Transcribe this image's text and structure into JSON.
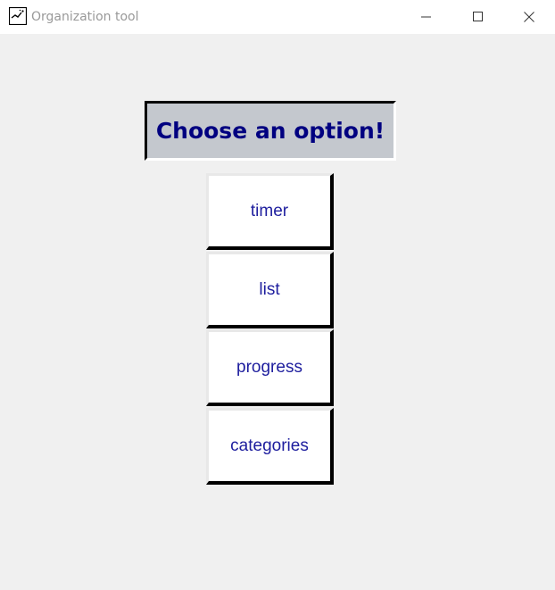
{
  "window": {
    "title": "Organization tool"
  },
  "colors": {
    "header_bg": "#c4c8ce",
    "header_text": "#000080",
    "button_text": "#1e1e9e",
    "window_bg": "#f0f0f0"
  },
  "icons": {
    "app": "app-window-icon",
    "minimize": "minimize-icon",
    "maximize": "maximize-icon",
    "close": "close-icon"
  },
  "main": {
    "heading": "Choose an option!",
    "buttons": [
      {
        "label": "timer"
      },
      {
        "label": "list"
      },
      {
        "label": "progress"
      },
      {
        "label": "categories"
      }
    ]
  }
}
